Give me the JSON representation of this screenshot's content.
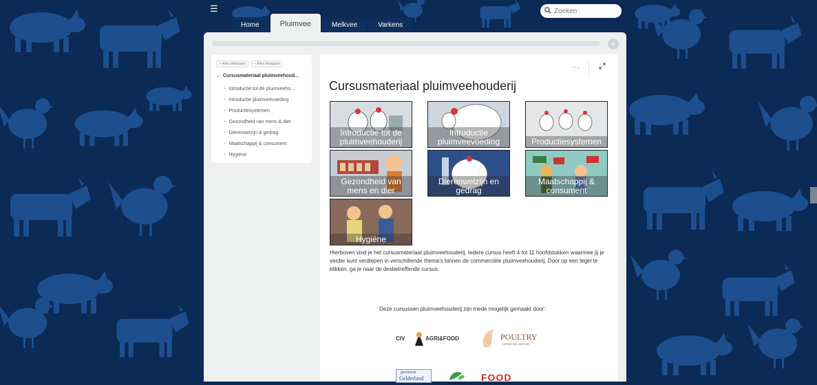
{
  "nav": {
    "tabs": [
      {
        "label": "Home"
      },
      {
        "label": "Pluimvee"
      },
      {
        "label": "Melkvee"
      },
      {
        "label": "Varkens"
      }
    ],
    "active_tab": "Pluimvee",
    "search_placeholder": "Zoeken"
  },
  "sidebar": {
    "expand_all": "Alles uitklappen",
    "collapse_all": "Alles inklappen",
    "course": "Cursusmateriaal pluimveehoud...",
    "items": [
      "Introductie tot de pluimveeho...",
      "Introductie pluimveevoeding",
      "Productiesystemen",
      "Gezondheid van mens & dier",
      "Dierenwelzijn & gedrag",
      "Maatschappij & consument",
      "Hygiëne"
    ]
  },
  "content": {
    "more": "...",
    "title": "Cursusmateriaal pluimveehouderij",
    "tiles": [
      {
        "label": "Introductie tot de pluimveehouderij"
      },
      {
        "label": "Introductie pluimveevoeding"
      },
      {
        "label": "Productiesystemen"
      },
      {
        "label": "Gezondheid van mens en dier"
      },
      {
        "label": "Dierenwelzijn en gedrag"
      },
      {
        "label": "Maatschappij & consument"
      },
      {
        "label": "Hygiëne"
      }
    ],
    "description": "Hierboven vind je het cursusmateriaal pluimveehouderij. Iedere cursus heeft 4 tot 11 hoofdstukken waarmee jij je verder kunt verdiepen in verschillende thema's binnen de commerciële pluimveehouderij. Door op een tegel te klikken, ga je naar de desbetreffende cursus.",
    "sponsor_text": "Deze cursussen pluimveehouderij zijn mede mogelijk gemaakt door:",
    "logos": {
      "civ": {
        "left": "CIV",
        "right": "AGRI&FOOD"
      },
      "poultry": {
        "main": "POULTRY",
        "sub": "EXPERTISE CENTRE"
      },
      "gelderland": {
        "line1": "provincie",
        "line2": "Gelderland"
      },
      "food": "FOOD"
    }
  },
  "colors": {
    "background": "#0b2a55",
    "silhouette": "#1d4f8e",
    "panel": "#eef0f0"
  }
}
